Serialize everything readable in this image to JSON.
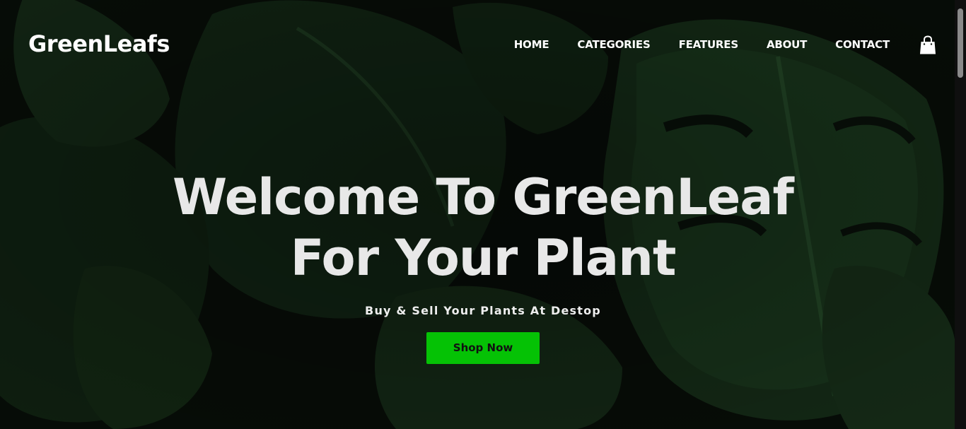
{
  "header": {
    "logo": "GreenLeafs",
    "nav": [
      {
        "label": "HOME"
      },
      {
        "label": "CATEGORIES"
      },
      {
        "label": "FEATURES"
      },
      {
        "label": "ABOUT"
      },
      {
        "label": "CONTACT"
      }
    ],
    "cart_icon": "shopping-bag-icon"
  },
  "hero": {
    "title_line1": "Welcome To GreenLeaf",
    "title_line2": "For Your Plant",
    "subtitle": "Buy & Sell Your Plants At Destop",
    "cta": "Shop Now"
  },
  "colors": {
    "accent": "#05c205",
    "background": "#0b140c",
    "text": "#e8e8e8"
  }
}
